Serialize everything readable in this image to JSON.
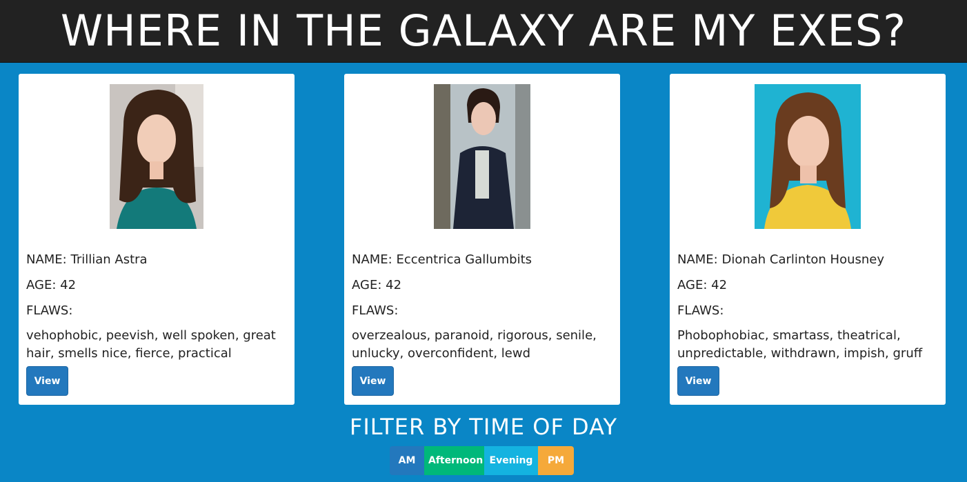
{
  "header": {
    "title": "WHERE IN THE GALAXY ARE MY EXES?"
  },
  "labels": {
    "name": "NAME:",
    "age": "AGE:",
    "flaws": "FLAWS:"
  },
  "exes": [
    {
      "name": "Trillian Astra",
      "age": "42",
      "flaws": "vehophobic, peevish, well spoken, great hair, smells nice, fierce, practical",
      "view_label": "View"
    },
    {
      "name": "Eccentrica Gallumbits",
      "age": "42",
      "flaws": "overzealous, paranoid, rigorous, senile, unlucky, overconfident, lewd",
      "view_label": "View"
    },
    {
      "name": "Dionah Carlinton Housney",
      "age": "42",
      "flaws": "Phobophobiac, smartass, theatrical, unpredictable, withdrawn, impish, gruff",
      "view_label": "View"
    }
  ],
  "filter": {
    "title": "FILTER BY TIME OF DAY",
    "options": [
      {
        "label": "AM",
        "color": "#2378bd"
      },
      {
        "label": "Afternoon",
        "color": "#00b87a"
      },
      {
        "label": "Evening",
        "color": "#14b3e0"
      },
      {
        "label": "PM",
        "color": "#f5a93a"
      }
    ]
  },
  "colors": {
    "page_bg": "#0a86c6",
    "header_bg": "#222222"
  }
}
